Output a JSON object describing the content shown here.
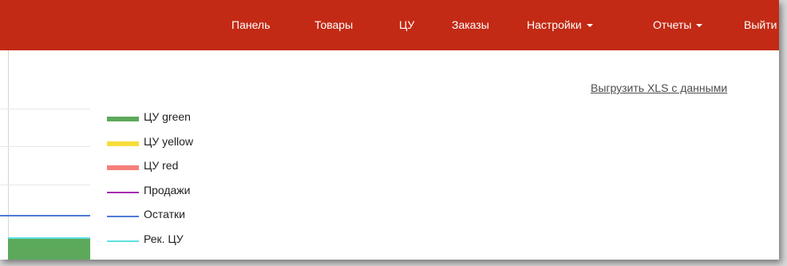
{
  "nav": {
    "items": [
      {
        "label": "Панель"
      },
      {
        "label": "Товары"
      },
      {
        "label": "ЦУ"
      },
      {
        "label": "Заказы"
      },
      {
        "label": "Настройки",
        "dropdown": true
      },
      {
        "label": "Отчеты",
        "dropdown": true
      },
      {
        "label": "Выйти"
      }
    ]
  },
  "toolbar": {
    "export_label": "Выгрузить XLS с данными"
  },
  "legend": {
    "items": [
      {
        "label": "ЦУ green",
        "color": "#5ca95c",
        "kind": "area"
      },
      {
        "label": "ЦУ yellow",
        "color": "#f7dd3c",
        "kind": "area"
      },
      {
        "label": "ЦУ red",
        "color": "#f5807a",
        "kind": "area"
      },
      {
        "label": "Продажи",
        "color": "#a32cb0",
        "kind": "line"
      },
      {
        "label": "Остатки",
        "color": "#4f7ad6",
        "kind": "line"
      },
      {
        "label": "Рек. ЦУ",
        "color": "#5fe0e0",
        "kind": "line"
      }
    ]
  },
  "colors": {
    "navbar": "#c22a15",
    "accent_text": "#ffffff"
  }
}
